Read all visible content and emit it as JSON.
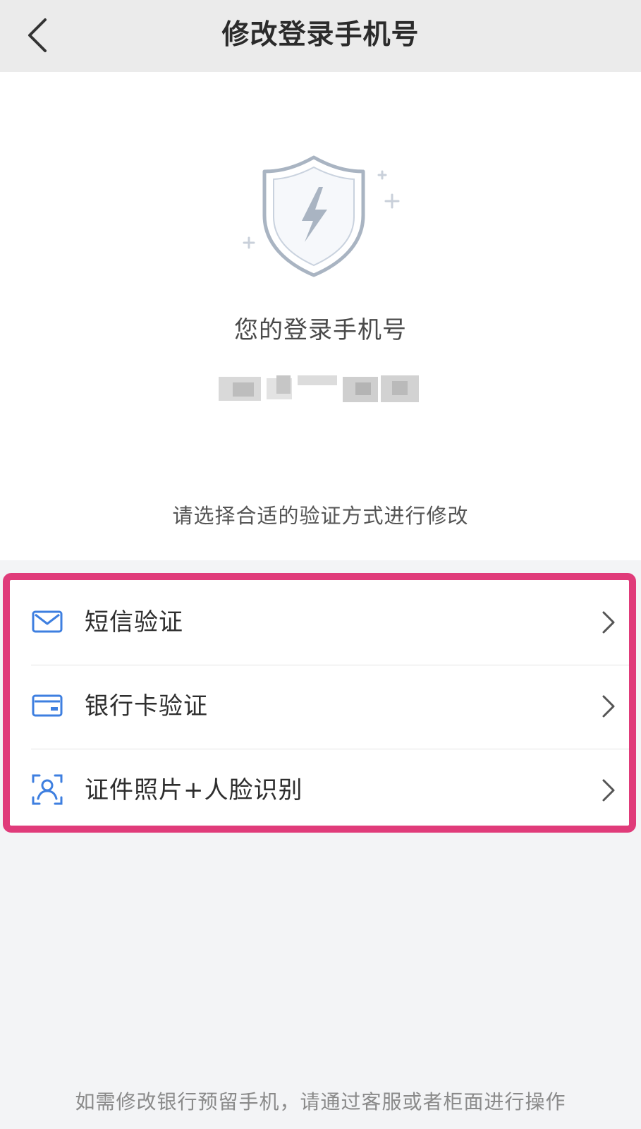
{
  "header": {
    "title": "修改登录手机号",
    "back_icon": "back-chevron-icon"
  },
  "main": {
    "shield_icon": "security-shield-icon",
    "phone_label": "您的登录手机号",
    "phone_number_masked": true,
    "hint": "请选择合适的验证方式进行修改"
  },
  "options": [
    {
      "label": "短信验证",
      "icon": "envelope-icon"
    },
    {
      "label": "银行卡验证",
      "icon": "bank-card-icon"
    },
    {
      "label": "证件照片+人脸识别",
      "icon": "face-id-icon"
    }
  ],
  "footer": {
    "note": "如需修改银行预留手机，请通过客服或者柜面进行操作"
  },
  "colors": {
    "accent_blue": "#3e7fe0",
    "highlight": "#e03b7a",
    "shield": "#a9b4c2"
  }
}
